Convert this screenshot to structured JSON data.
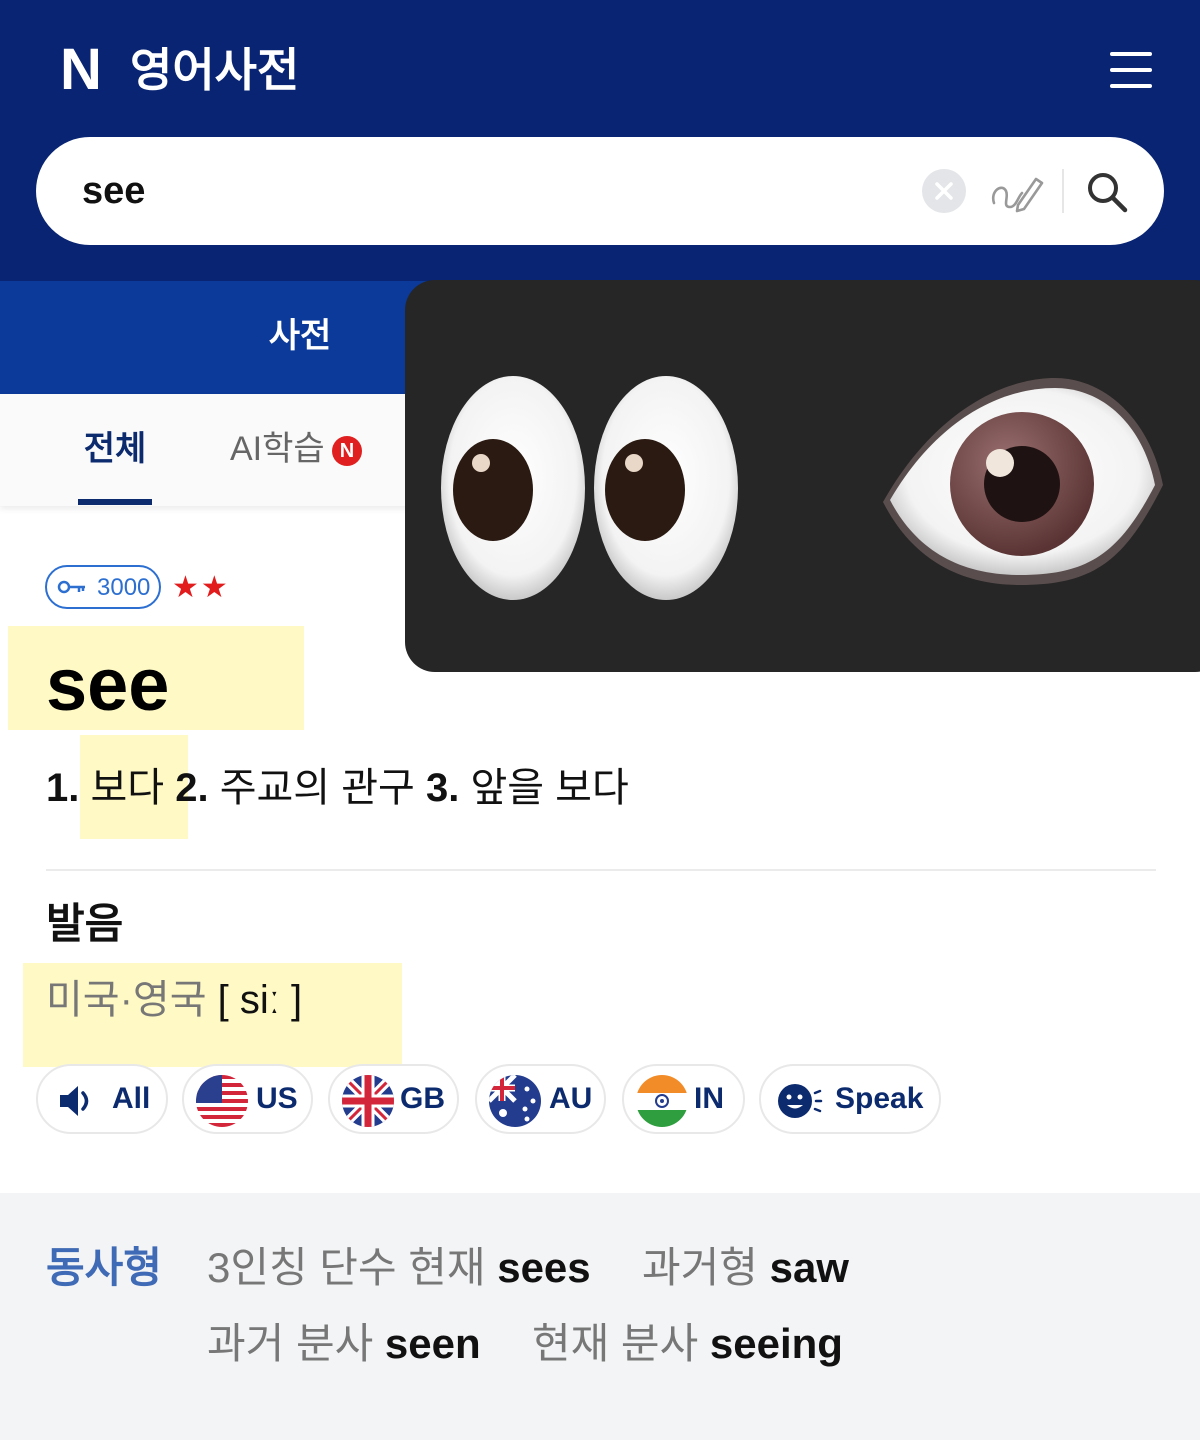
{
  "header": {
    "logo": "N",
    "title": "영어사전"
  },
  "search": {
    "value": "see"
  },
  "tabs": {
    "dict": "사전"
  },
  "subtabs": {
    "all": "전체",
    "ai": "AI학습",
    "ai_badge": "N"
  },
  "entry": {
    "level": "3000",
    "stars": "★★",
    "word": "see",
    "meanings": [
      {
        "num": "1.",
        "text": "보다"
      },
      {
        "num": "2.",
        "text": "주교의 관구"
      },
      {
        "num": "3.",
        "text": "앞을 보다"
      }
    ]
  },
  "pronunciation": {
    "heading": "발음",
    "region": "미국·영국",
    "ipa": "[ siː ]",
    "buttons": [
      "All",
      "US",
      "GB",
      "AU",
      "IN",
      "Speak"
    ]
  },
  "verb_forms": {
    "label": "동사형",
    "items": [
      {
        "label": "3인칭 단수 현재",
        "value": "sees"
      },
      {
        "label": "과거형",
        "value": "saw"
      },
      {
        "label": "과거 분사",
        "value": "seen"
      },
      {
        "label": "현재 분사",
        "value": "seeing"
      }
    ]
  },
  "icons": [
    "menu-icon",
    "clear-icon",
    "handwriting-icon",
    "search-icon",
    "eyes-emoji",
    "eye-emoji",
    "key-icon",
    "speaker-icon",
    "us-flag-icon",
    "gb-flag-icon",
    "au-flag-icon",
    "in-flag-icon",
    "speak-icon"
  ],
  "colors": {
    "header_bg": "#082472",
    "tabbar_bg": "#0b3a9a",
    "accent": "#0c2a6e",
    "highlight": "#fff696"
  }
}
